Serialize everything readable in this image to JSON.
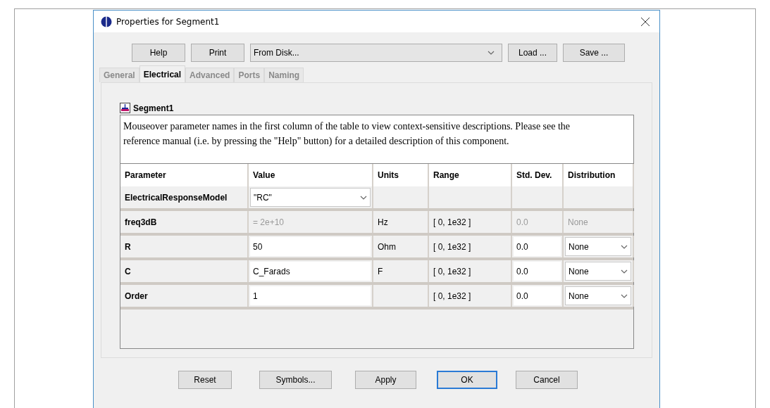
{
  "window": {
    "title": "Properties for Segment1"
  },
  "toolbar": {
    "buttons_left": [
      "Help",
      "Print"
    ],
    "source": {
      "value": "From Disk..."
    },
    "buttons_right": [
      "Load ...",
      "Save ..."
    ]
  },
  "tabs": [
    {
      "label": "General",
      "selected": false
    },
    {
      "label": "Electrical",
      "selected": true
    },
    {
      "label": "Advanced",
      "selected": false
    },
    {
      "label": "Ports",
      "selected": false
    },
    {
      "label": "Naming",
      "selected": false
    }
  ],
  "component": {
    "name": "Segment1",
    "description": "Mouseover parameter names in the first column of the table to view context-sensitive descriptions. Please see the reference manual (i.e. by pressing the \"Help\" button) for a detailed description of this component."
  },
  "table": {
    "columns": [
      "Parameter",
      "Value",
      "Units",
      "Range",
      "Std. Dev.",
      "Distribution"
    ],
    "rows": [
      {
        "parameter": "ElectricalResponseModel",
        "value": {
          "kind": "dropdown",
          "text": "\"RC\""
        }
      },
      {
        "parameter": "freq3dB",
        "value": {
          "kind": "readonly",
          "text": "= 2e+10"
        },
        "units": "Hz",
        "range": "[ 0, 1e32 ]",
        "std_dev": {
          "kind": "readonly",
          "text": "0.0"
        },
        "distribution": {
          "kind": "readonly",
          "text": "None"
        }
      },
      {
        "parameter": "R",
        "value": {
          "kind": "field",
          "text": "50"
        },
        "units": "Ohm",
        "range": "[ 0, 1e32 ]",
        "std_dev": {
          "kind": "field",
          "text": "0.0"
        },
        "distribution": {
          "kind": "dropdown",
          "text": "None"
        }
      },
      {
        "parameter": "C",
        "value": {
          "kind": "field",
          "text": "C_Farads"
        },
        "units": "F",
        "range": "[ 0, 1e32 ]",
        "std_dev": {
          "kind": "field",
          "text": "0.0"
        },
        "distribution": {
          "kind": "dropdown",
          "text": "None"
        }
      },
      {
        "parameter": "Order",
        "value": {
          "kind": "field",
          "text": "1"
        },
        "range": "[ 0, 1e32 ]",
        "std_dev": {
          "kind": "field",
          "text": "0.0"
        },
        "distribution": {
          "kind": "dropdown",
          "text": "None"
        }
      }
    ]
  },
  "buttons": [
    {
      "label": "Reset",
      "focused": false
    },
    {
      "label": "Symbols...",
      "focused": false
    },
    {
      "label": "Apply",
      "focused": false
    },
    {
      "label": "OK",
      "focused": true
    },
    {
      "label": "Cancel",
      "focused": false
    }
  ]
}
